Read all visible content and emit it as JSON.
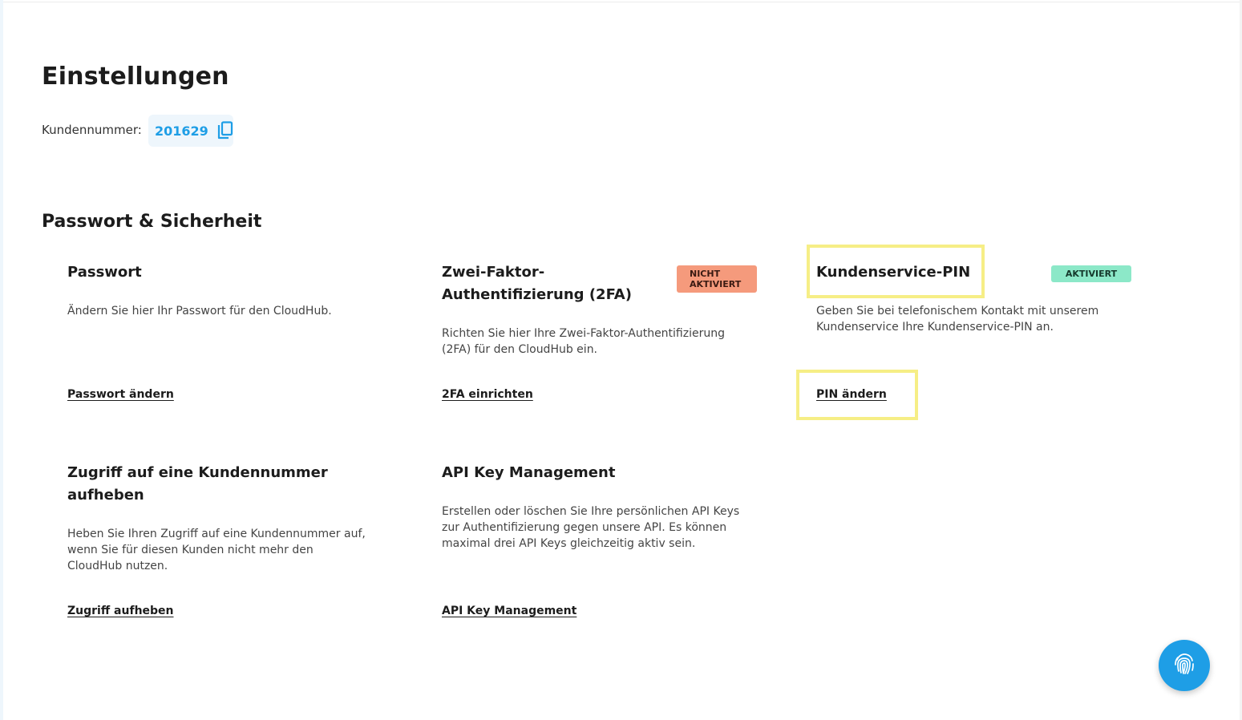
{
  "page": {
    "title": "Einstellungen",
    "customer_label": "Kundennummer:",
    "customer_number": "201629"
  },
  "section": {
    "title": "Passwort & Sicherheit"
  },
  "cards": {
    "password": {
      "title": "Passwort",
      "description": "Ändern Sie hier Ihr Passwort für den CloudHub.",
      "link": "Passwort ändern"
    },
    "twofa": {
      "title_line1": "Zwei-Faktor-",
      "title_line2": "Authentifizierung (2FA)",
      "badge_line1": "NICHT",
      "badge_line2": "AKTIVIERT",
      "description_line1": "Richten Sie hier Ihre Zwei-Faktor-Authentifizierung",
      "description_line2": "(2FA) für den CloudHub ein.",
      "link": "2FA einrichten"
    },
    "pin": {
      "title": "Kundenservice-PIN",
      "badge": "AKTIVIERT",
      "description_line1": "Geben Sie bei telefonischem Kontakt mit unserem",
      "description_line2": "Kundenservice Ihre Kundenservice-PIN an.",
      "link": "PIN ändern"
    },
    "revoke": {
      "title_line1": "Zugriff auf eine Kundennummer",
      "title_line2": "aufheben",
      "description_line1": "Heben Sie Ihren Zugriff auf eine Kundennummer auf,",
      "description_line2": "wenn Sie für diesen Kunden nicht mehr den",
      "description_line3": "CloudHub nutzen.",
      "link": "Zugriff aufheben"
    },
    "api": {
      "title": "API Key Management",
      "description_line1": "Erstellen oder löschen Sie Ihre persönlichen API Keys",
      "description_line2": "zur Authentifizierung gegen unsere API. Es können",
      "description_line3": "maximal drei API Keys gleichzeitig aktiv sein.",
      "link": "API Key Management"
    }
  },
  "icons": {
    "copy": "copy-icon",
    "fab": "fingerprint-icon"
  },
  "colors": {
    "accent": "#1e9ee6",
    "badge_inactive": "#f59a7c",
    "badge_active": "#8ce8c8",
    "highlight": "#f6ee86"
  }
}
